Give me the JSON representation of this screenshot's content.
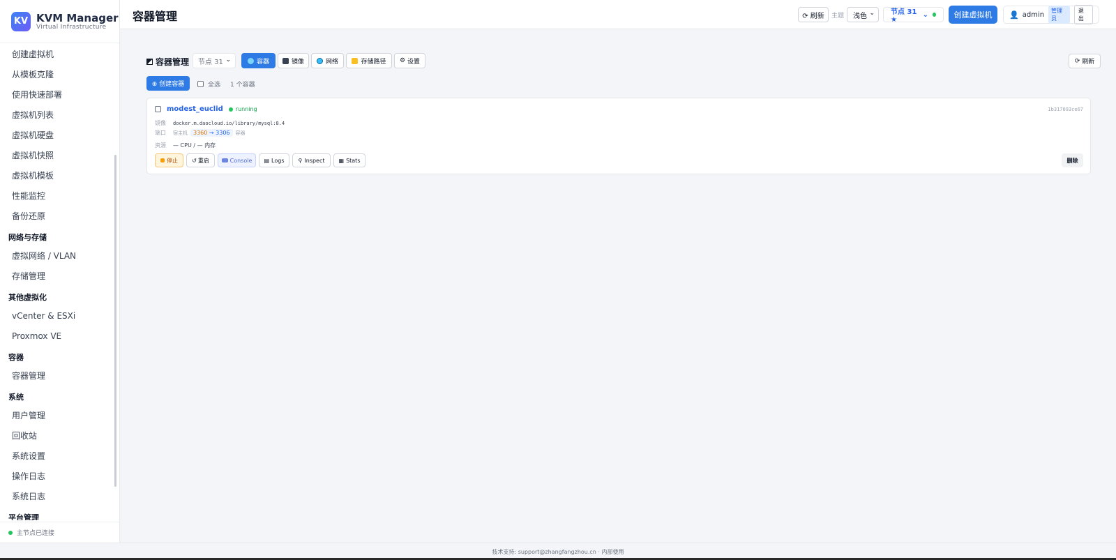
{
  "brand": {
    "logo_text": "KV",
    "title": "KVM Manager",
    "subtitle": "Virtual Infrastructure"
  },
  "sidebar": {
    "items": [
      {
        "type": "item",
        "label": "创建虚拟机"
      },
      {
        "type": "item",
        "label": "从模板克隆"
      },
      {
        "type": "item",
        "label": "使用快速部署"
      },
      {
        "type": "item",
        "label": "虚拟机列表"
      },
      {
        "type": "item",
        "label": "虚拟机硬盘"
      },
      {
        "type": "item",
        "label": "虚拟机快照"
      },
      {
        "type": "item",
        "label": "虚拟机模板"
      },
      {
        "type": "item",
        "label": "性能监控"
      },
      {
        "type": "item",
        "label": "备份还原"
      },
      {
        "type": "section",
        "label": "网络与存储"
      },
      {
        "type": "item",
        "label": "虚拟网络 / VLAN"
      },
      {
        "type": "item",
        "label": "存储管理"
      },
      {
        "type": "section",
        "label": "其他虚拟化"
      },
      {
        "type": "item",
        "label": "vCenter & ESXi"
      },
      {
        "type": "item",
        "label": "Proxmox VE"
      },
      {
        "type": "section",
        "label": "容器"
      },
      {
        "type": "item",
        "label": "容器管理"
      },
      {
        "type": "section",
        "label": "系统"
      },
      {
        "type": "item",
        "label": "用户管理"
      },
      {
        "type": "item",
        "label": "回收站"
      },
      {
        "type": "item",
        "label": "系统设置"
      },
      {
        "type": "item",
        "label": "操作日志"
      },
      {
        "type": "item",
        "label": "系统日志"
      },
      {
        "type": "section",
        "label": "平台管理"
      }
    ],
    "footer_status": "主节点已连接"
  },
  "header": {
    "page_title": "容器管理",
    "refresh_label": "⟳ 刷新",
    "theme_label": "主题",
    "theme_value": "浅色",
    "node_label": "节点 31 ★",
    "create_vm_label": "创建虚拟机",
    "user_name": "admin",
    "user_role": "管理员",
    "logout_label": "退出"
  },
  "container_page": {
    "section_title": "容器管理",
    "node_select": "节点 31",
    "tabs": [
      {
        "label": "容器",
        "active": true
      },
      {
        "label": "镜像",
        "active": false
      },
      {
        "label": "网络",
        "active": false
      },
      {
        "label": "存储路径",
        "active": false
      },
      {
        "label": "设置",
        "active": false
      }
    ],
    "refresh_label": "刷新",
    "create_label": "⊕ 创建容器",
    "select_all_label": "全选",
    "count_label": "1 个容器"
  },
  "containers": [
    {
      "name": "modest_euclid",
      "status": "running",
      "id": "1b317093ce67",
      "image_label": "镜像",
      "image": "docker.m.daocloud.io/library/mysql:8.4",
      "port_label": "端口",
      "host_tag": "宿主机",
      "host_port": "3360",
      "arrow": "→",
      "container_port": "3306",
      "container_tag": "容器",
      "resource_label": "资源",
      "resource": "— CPU / — 内存",
      "actions": {
        "stop": "停止",
        "restart": "重启",
        "console": "Console",
        "logs": "Logs",
        "inspect": "Inspect",
        "stats": "Stats",
        "delete": "删除"
      }
    }
  ],
  "footer": {
    "text": "技术支持: support@zhangfangzhou.cn · 内部使用"
  },
  "colors": {
    "accent": "#2f7be6",
    "running": "#16a34a",
    "stop_bg": "#fff4dc"
  }
}
